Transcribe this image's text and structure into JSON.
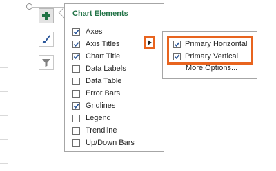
{
  "panel": {
    "title": "Chart Elements",
    "items": [
      {
        "label": "Axes",
        "checked": true
      },
      {
        "label": "Axis Titles",
        "checked": true
      },
      {
        "label": "Chart Title",
        "checked": true
      },
      {
        "label": "Data Labels",
        "checked": false
      },
      {
        "label": "Data Table",
        "checked": false
      },
      {
        "label": "Error Bars",
        "checked": false
      },
      {
        "label": "Gridlines",
        "checked": true
      },
      {
        "label": "Legend",
        "checked": false
      },
      {
        "label": "Trendline",
        "checked": false
      },
      {
        "label": "Up/Down Bars",
        "checked": false
      }
    ]
  },
  "side_buttons": [
    {
      "icon": "plus-icon",
      "active": true
    },
    {
      "icon": "brush-icon",
      "active": false
    },
    {
      "icon": "filter-icon",
      "active": false
    }
  ],
  "submenu": {
    "items": [
      {
        "label": "Primary Horizontal",
        "checked": true
      },
      {
        "label": "Primary Vertical",
        "checked": true
      }
    ],
    "more_label": "More Options..."
  },
  "colors": {
    "accent_green": "#217346",
    "highlight_orange": "#e8641f",
    "check_blue": "#2b579a"
  }
}
